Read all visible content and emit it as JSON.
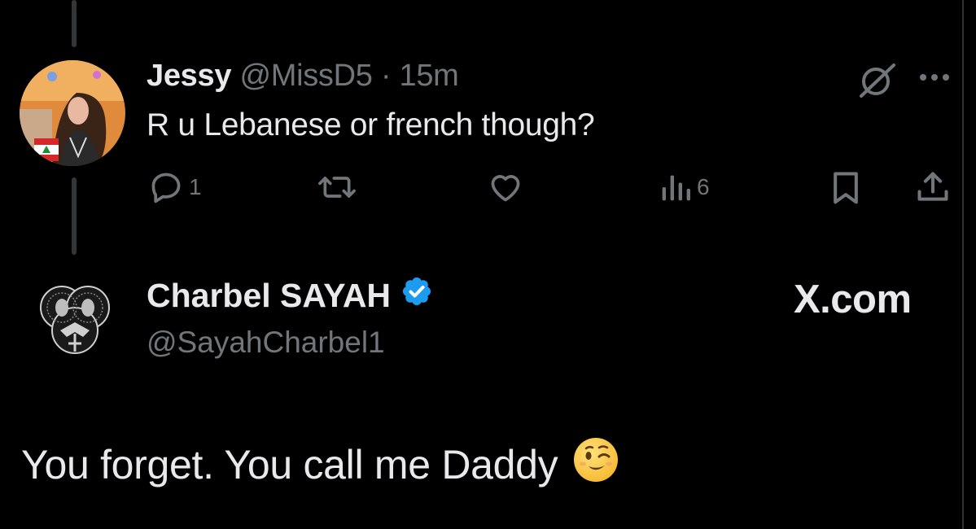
{
  "parent_tweet": {
    "display_name": "Jessy",
    "handle": "@MissD5",
    "separator": "·",
    "time": "15m",
    "text": "R u Lebanese or french though?",
    "actions": {
      "reply": {
        "icon": "reply-icon",
        "count": "1"
      },
      "retweet": {
        "icon": "retweet-icon"
      },
      "like": {
        "icon": "heart-icon"
      },
      "views": {
        "icon": "views-icon",
        "count": "6"
      },
      "bookmark": {
        "icon": "bookmark-icon"
      },
      "share": {
        "icon": "share-icon"
      }
    }
  },
  "reply_tweet": {
    "display_name": "Charbel SAYAH",
    "verified": true,
    "handle": "@SayahCharbel1",
    "watermark": "X.com",
    "text": "You forget. You call me Daddy",
    "emoji": "winking-face"
  },
  "colors": {
    "background": "#000000",
    "text": "#e7e9ea",
    "muted": "#71767b",
    "verified_blue": "#1d9bf0",
    "thread_line": "#333639"
  }
}
